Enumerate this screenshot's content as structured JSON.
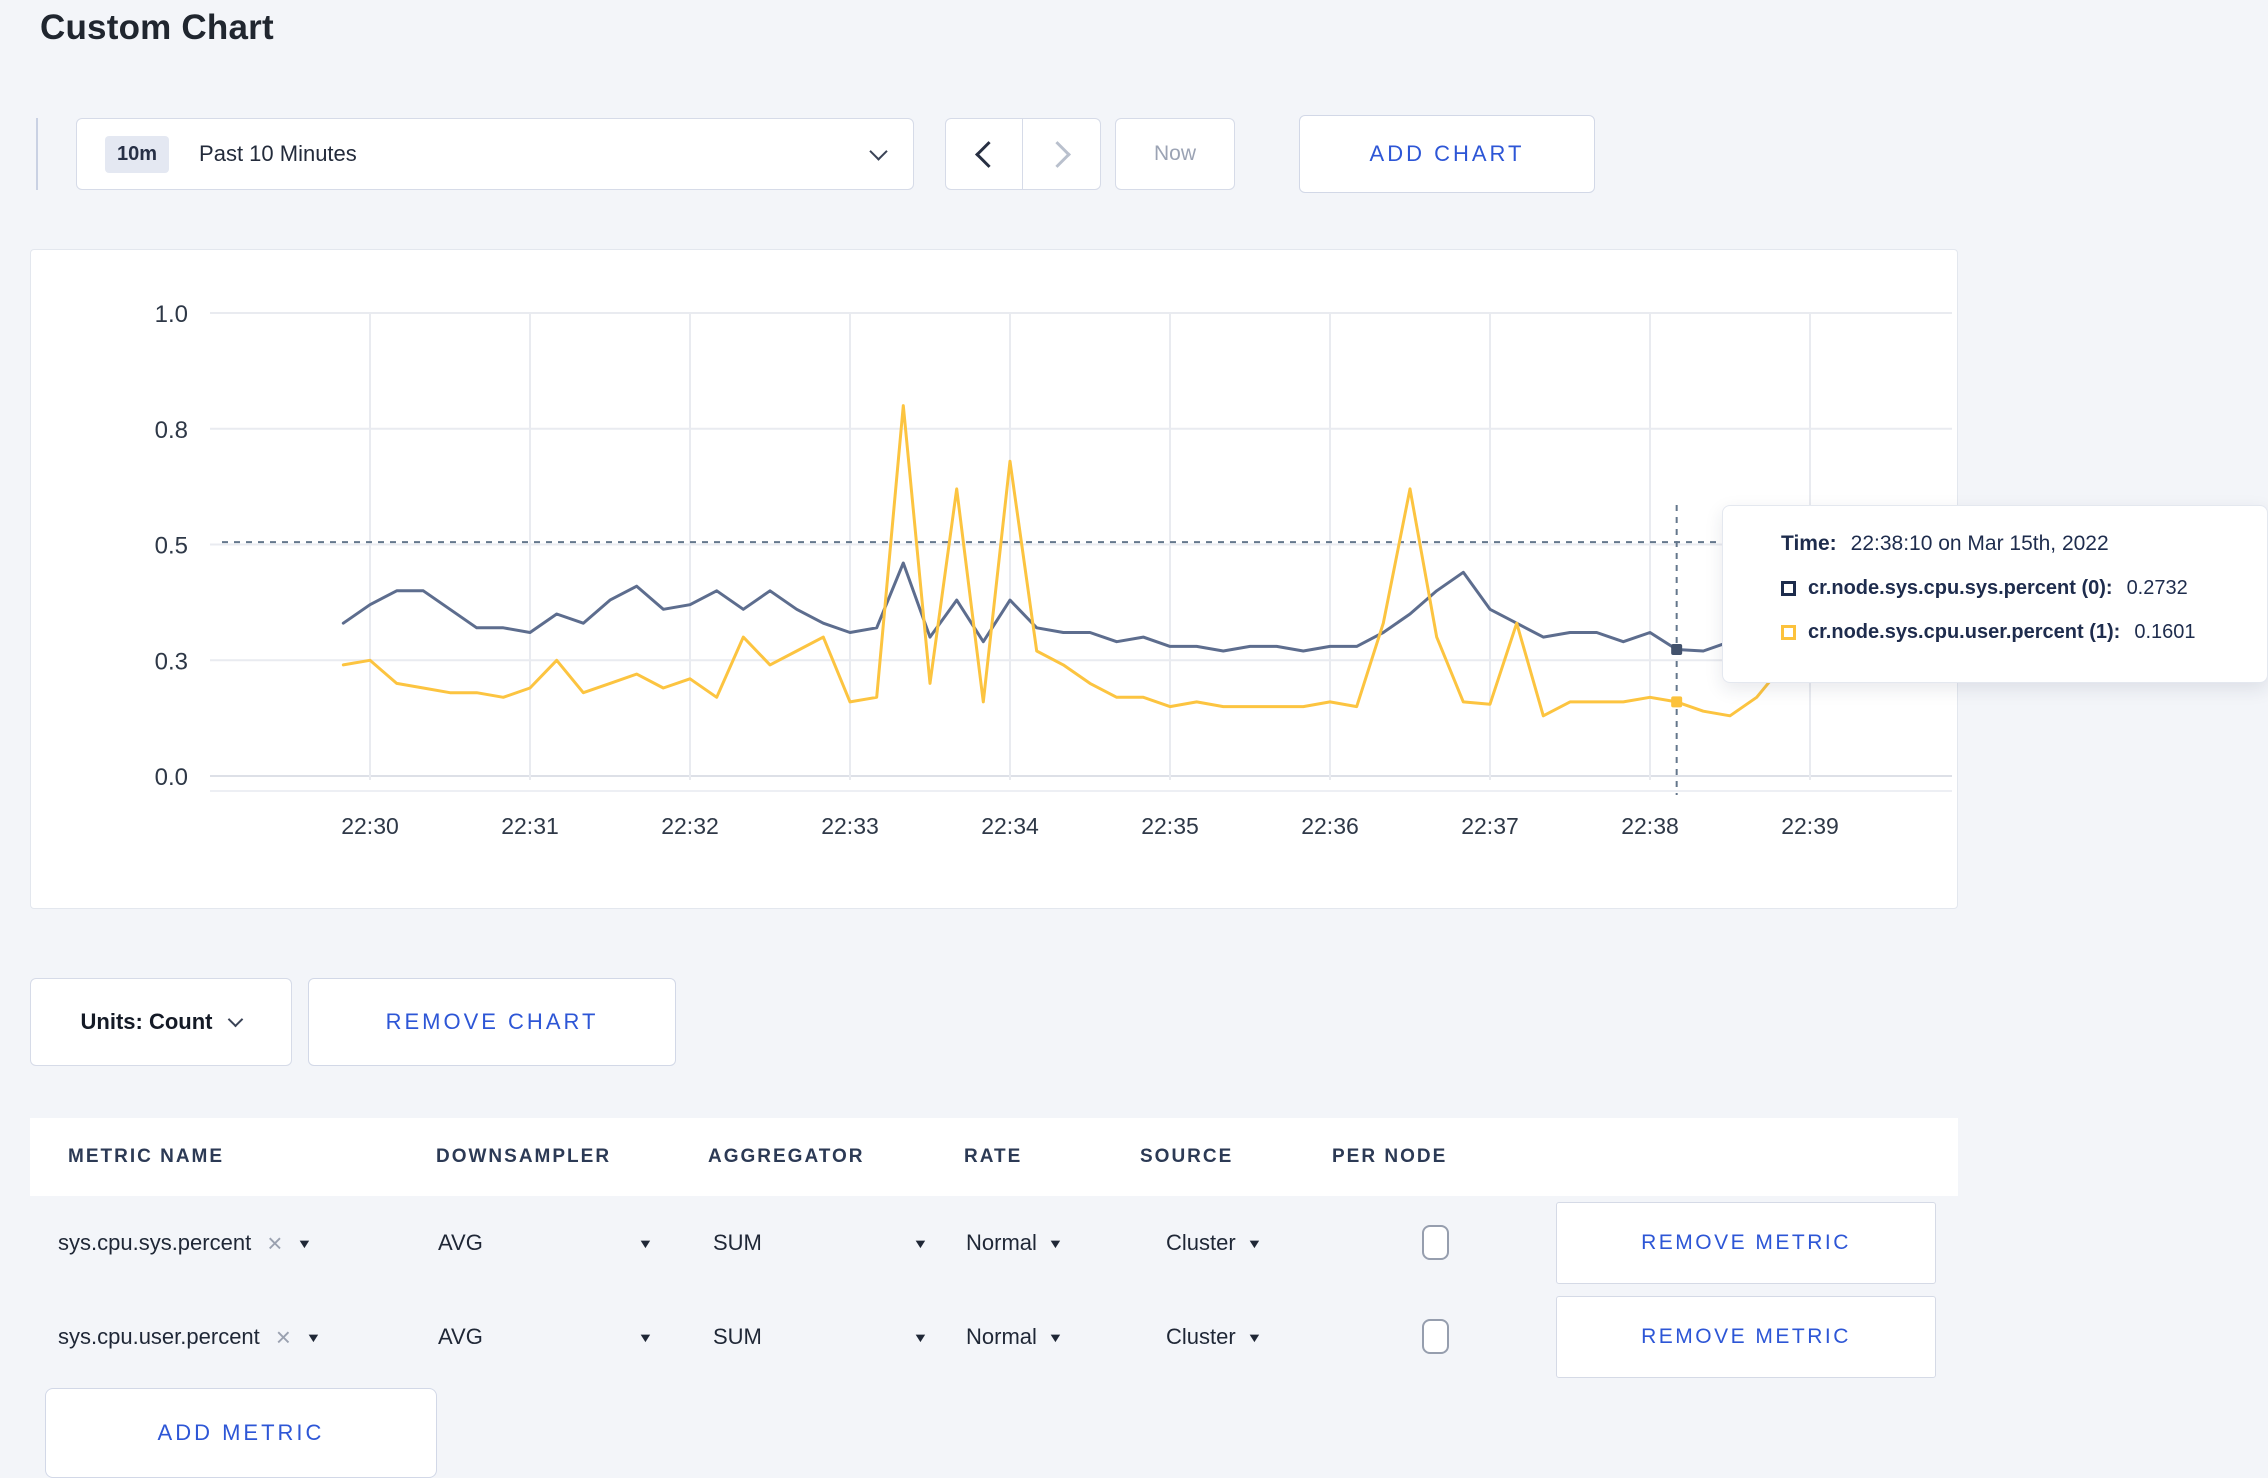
{
  "page": {
    "title": "Custom Chart"
  },
  "toolbar": {
    "time_range": {
      "badge": "10m",
      "label": "Past 10 Minutes"
    },
    "now_label": "Now",
    "add_chart_label": "ADD CHART"
  },
  "chart_controls": {
    "units_label": "Units: Count",
    "remove_chart_label": "REMOVE CHART"
  },
  "tooltip": {
    "time_label": "Time:",
    "time_value": "22:38:10 on Mar 15th, 2022",
    "series": [
      {
        "name": "cr.node.sys.cpu.sys.percent (0):",
        "value": "0.2732",
        "color": "#1d2c4c"
      },
      {
        "name": "cr.node.sys.cpu.user.percent (1):",
        "value": "0.1601",
        "color": "#fcc23c"
      }
    ]
  },
  "chart_data": {
    "type": "line",
    "title": "",
    "xlabel": "",
    "ylabel": "",
    "ylim": [
      0,
      1
    ],
    "grid": true,
    "legend_position": "tooltip-overlay",
    "y_tick_values": [
      0,
      0.25,
      0.5,
      0.75,
      1.0
    ],
    "y_tick_labels": [
      "0.0",
      "0.3",
      "0.5",
      "0.8",
      "1.0"
    ],
    "x_ticks": [
      "22:30",
      "22:31",
      "22:32",
      "22:33",
      "22:34",
      "22:35",
      "22:36",
      "22:37",
      "22:38",
      "22:39"
    ],
    "x_start_time": "22:29:50",
    "x_interval_seconds": 10,
    "series": [
      {
        "name": "cr.node.sys.cpu.sys.percent",
        "color": "#5d6d8e",
        "dot_color": "#42526d",
        "values": [
          0.33,
          0.37,
          0.4,
          0.4,
          0.36,
          0.32,
          0.32,
          0.31,
          0.35,
          0.33,
          0.38,
          0.41,
          0.36,
          0.37,
          0.4,
          0.36,
          0.4,
          0.36,
          0.33,
          0.31,
          0.32,
          0.46,
          0.3,
          0.38,
          0.29,
          0.38,
          0.32,
          0.31,
          0.31,
          0.29,
          0.3,
          0.28,
          0.28,
          0.27,
          0.28,
          0.28,
          0.27,
          0.28,
          0.28,
          0.31,
          0.35,
          0.4,
          0.44,
          0.36,
          0.33,
          0.3,
          0.31,
          0.31,
          0.29,
          0.31,
          0.2732,
          0.27,
          0.29,
          0.32,
          0.33,
          0.3,
          0.3
        ]
      },
      {
        "name": "cr.node.sys.cpu.user.percent",
        "color": "#fcc440",
        "dot_color": "#fcc23c",
        "values": [
          0.24,
          0.25,
          0.2,
          0.19,
          0.18,
          0.18,
          0.17,
          0.19,
          0.25,
          0.18,
          0.2,
          0.22,
          0.19,
          0.21,
          0.17,
          0.3,
          0.24,
          0.27,
          0.3,
          0.16,
          0.17,
          0.8,
          0.2,
          0.62,
          0.16,
          0.68,
          0.27,
          0.24,
          0.2,
          0.17,
          0.17,
          0.15,
          0.16,
          0.15,
          0.15,
          0.15,
          0.15,
          0.16,
          0.15,
          0.33,
          0.62,
          0.3,
          0.16,
          0.155,
          0.33,
          0.13,
          0.16,
          0.16,
          0.16,
          0.17,
          0.1601,
          0.14,
          0.13,
          0.17,
          0.24,
          0.27,
          0.22
        ]
      }
    ],
    "crosshair": {
      "time": "22:38:10",
      "hline_value": 0.505,
      "values": [
        0.2732,
        0.1601
      ]
    }
  },
  "metrics_table": {
    "headers": [
      "METRIC NAME",
      "DOWNSAMPLER",
      "AGGREGATOR",
      "RATE",
      "SOURCE",
      "PER NODE"
    ],
    "rows": [
      {
        "metric_name": "sys.cpu.sys.percent",
        "downsampler": "AVG",
        "aggregator": "SUM",
        "rate": "Normal",
        "source": "Cluster",
        "per_node_checked": false,
        "remove_label": "REMOVE METRIC"
      },
      {
        "metric_name": "sys.cpu.user.percent",
        "downsampler": "AVG",
        "aggregator": "SUM",
        "rate": "Normal",
        "source": "Cluster",
        "per_node_checked": false,
        "remove_label": "REMOVE METRIC"
      }
    ],
    "add_metric_label": "ADD METRIC"
  },
  "icons": {
    "caret": "▼",
    "clear": "×"
  },
  "colors": {
    "accent_blue": "#2d56d6",
    "series_sys": "#5d6d8e",
    "series_user": "#fcc440",
    "page_bg": "#f3f5f9",
    "grid": "#e9ebf0",
    "crosshair": "#64778c"
  }
}
